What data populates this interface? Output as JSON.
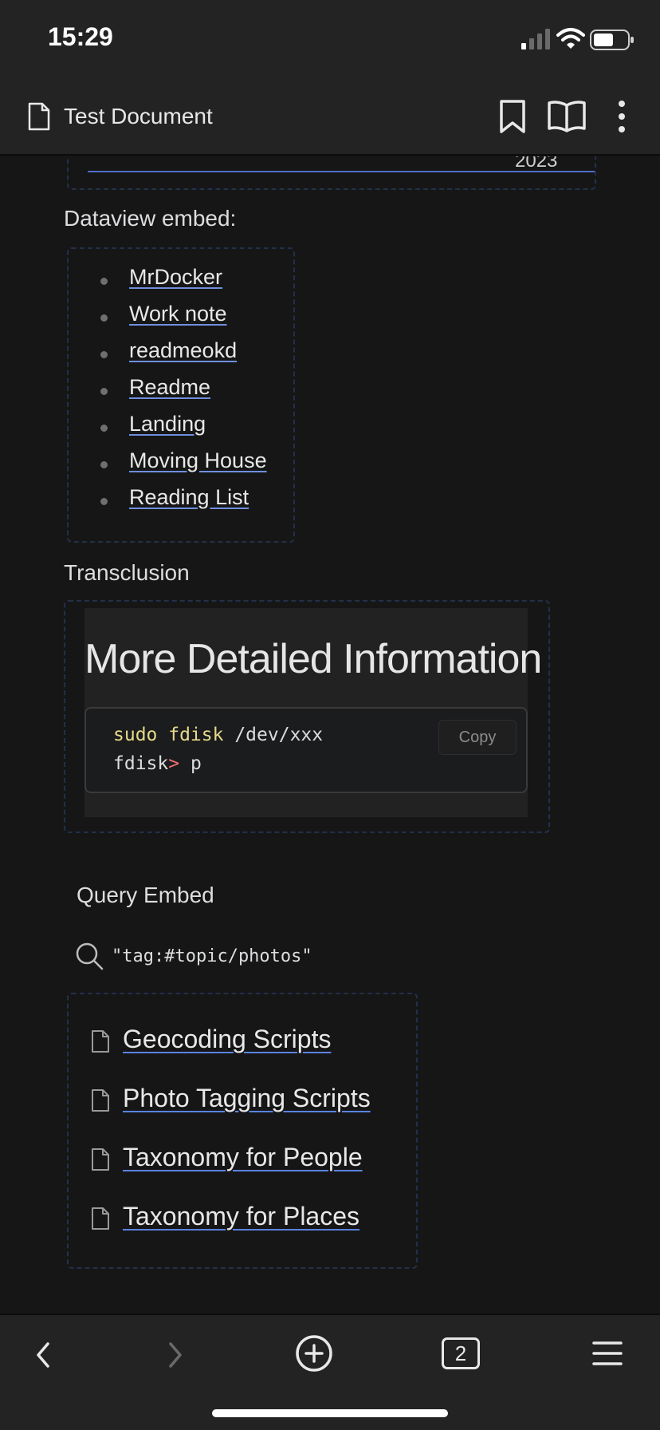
{
  "status": {
    "time": "15:29"
  },
  "header": {
    "title": "Test Document"
  },
  "top_embed": {
    "year_partial": "2023"
  },
  "dataview": {
    "label": "Dataview embed:",
    "items": [
      "MrDocker",
      "Work note",
      "readmeokd",
      "Readme",
      "Landing",
      "Moving House",
      "Reading List"
    ]
  },
  "transclusion": {
    "label": "Transclusion",
    "heading": "More Detailed Information",
    "code": {
      "line1_cmd": "sudo fdisk",
      "line1_arg": " /dev/xxx",
      "line2_prompt": "fdisk",
      "line2_gt": ">",
      "line2_arg": " p"
    },
    "copy_label": "Copy"
  },
  "query_embed": {
    "label": "Query Embed",
    "query": "\"tag:#topic/photos\"",
    "results": [
      "Geocoding Scripts",
      "Photo Tagging Scripts",
      "Taxonomy for People",
      "Taxonomy for Places"
    ]
  },
  "toolbar": {
    "tab_count": "2"
  },
  "colors": {
    "background": "#161617",
    "chrome": "#232324",
    "link_underline": "#5b83e0",
    "embed_border": "#22304a"
  }
}
